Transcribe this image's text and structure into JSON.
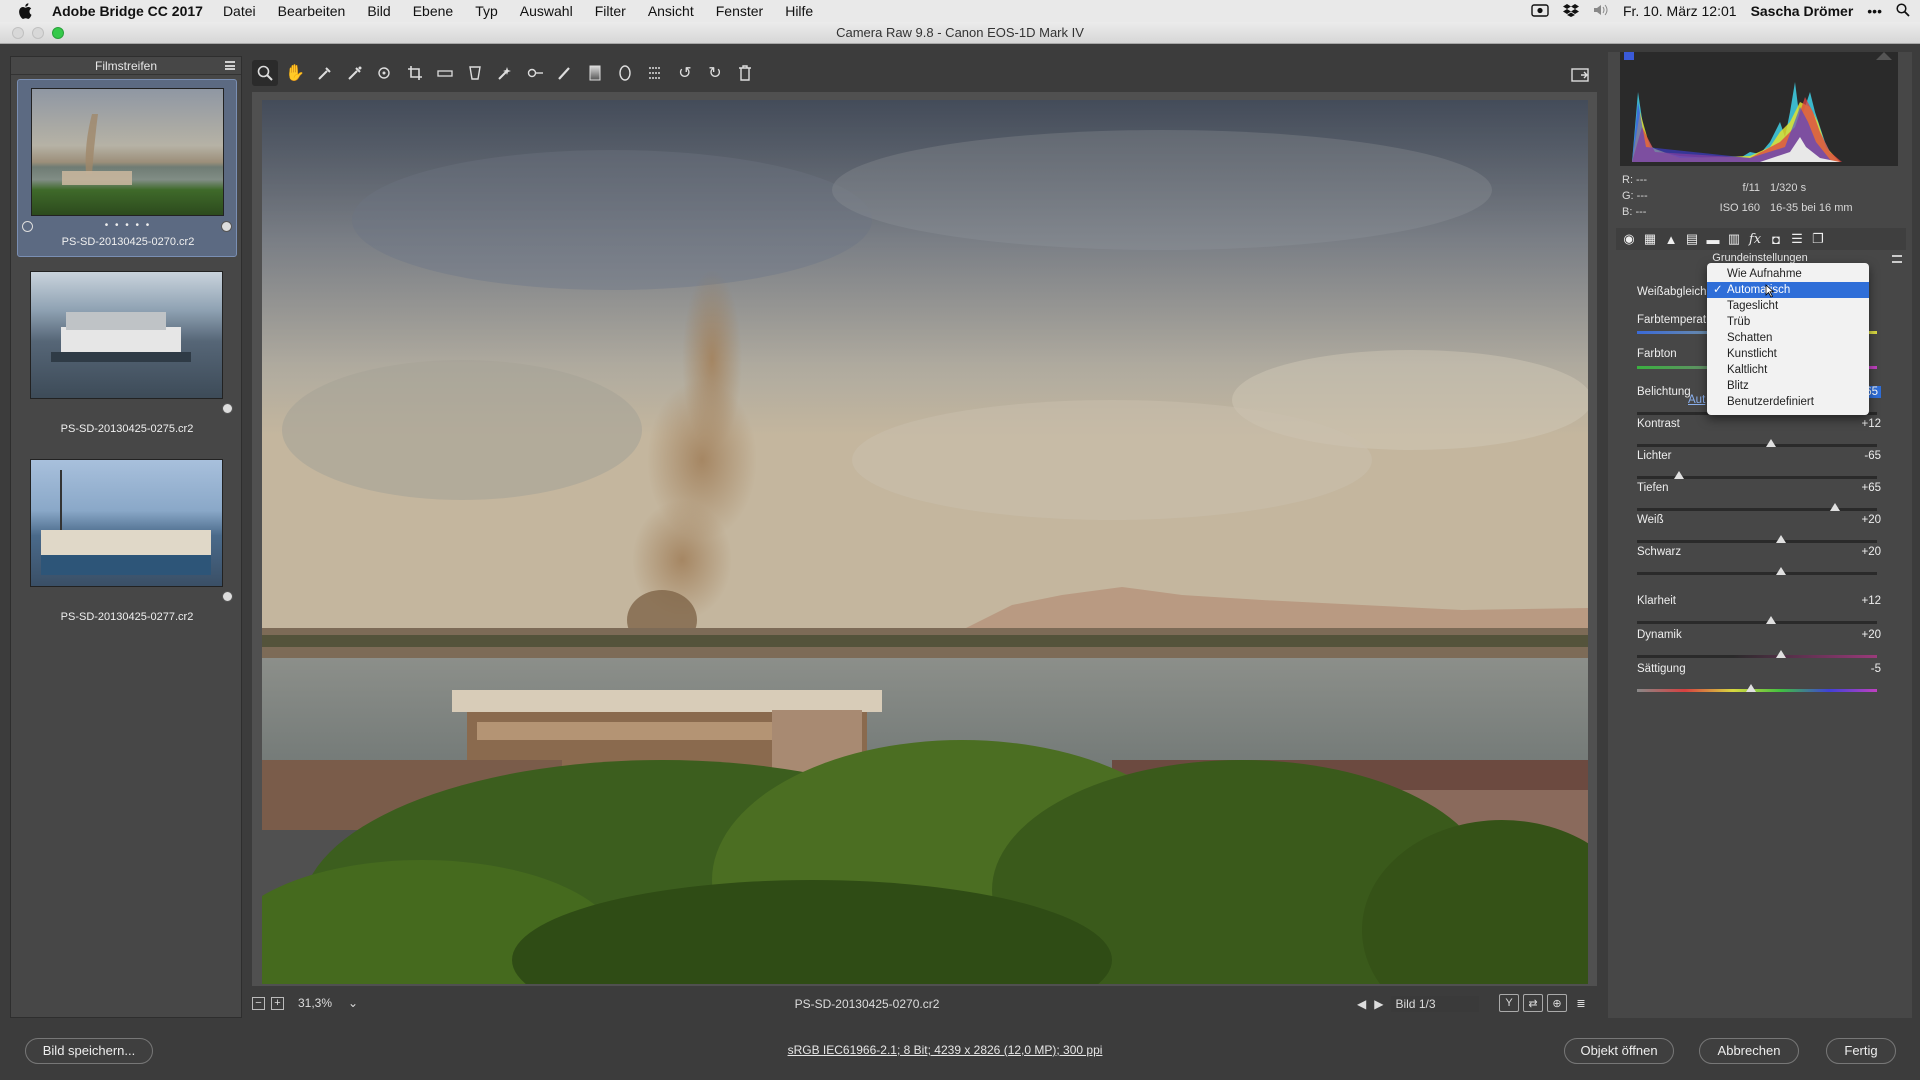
{
  "menubar": {
    "app": "Adobe Bridge CC 2017",
    "items": [
      "Datei",
      "Bearbeiten",
      "Bild",
      "Ebene",
      "Typ",
      "Auswahl",
      "Filter",
      "Ansicht",
      "Fenster",
      "Hilfe"
    ],
    "datetime": "Fr. 10. März  12:01",
    "user": "Sascha Drömer"
  },
  "window": {
    "title": "Camera Raw 9.8  -  Canon EOS-1D Mark IV"
  },
  "filmstrip": {
    "title": "Filmstreifen",
    "items": [
      {
        "name": "PS-SD-20130425-0270.cr2",
        "selected": true,
        "rating_dots": "• • • • •"
      },
      {
        "name": "PS-SD-20130425-0275.cr2",
        "selected": false
      },
      {
        "name": "PS-SD-20130425-0277.cr2",
        "selected": false
      }
    ]
  },
  "statusbar": {
    "zoom": "31,3%",
    "filename": "PS-SD-20130425-0270.cr2",
    "page": "Bild 1/3"
  },
  "histogram": {
    "rgb": {
      "r": "R:   ---",
      "g": "G:   ---",
      "b": "B:   ---"
    },
    "aperture": "f/11",
    "shutter": "1/320 s",
    "iso": "ISO 160",
    "lens": "16-35 bei 16 mm"
  },
  "panel": {
    "section_title": "Grundeinstellungen",
    "wb_label": "Weißabgleich",
    "temp_label": "Farbtemperat",
    "tint_label": "Farbton",
    "auto_link": "Aut",
    "sliders": [
      {
        "label": "Belichtung",
        "value": "-0,65",
        "level": 0.43,
        "highlight": true
      },
      {
        "label": "Kontrast",
        "value": "+12",
        "level": 0.56
      },
      {
        "label": "Lichter",
        "value": "-65",
        "level": 0.175
      },
      {
        "label": "Tiefen",
        "value": "+65",
        "level": 0.825
      },
      {
        "label": "Weiß",
        "value": "+20",
        "level": 0.6
      },
      {
        "label": "Schwarz",
        "value": "+20",
        "level": 0.6
      },
      {
        "label": "Klarheit",
        "value": "+12",
        "level": 0.56
      },
      {
        "label": "Dynamik",
        "value": "+20",
        "level": 0.6
      },
      {
        "label": "Sättigung",
        "value": "-5",
        "level": 0.475
      }
    ]
  },
  "wb_menu": {
    "options": [
      "Wie Aufnahme",
      "Automatisch",
      "Tageslicht",
      "Trüb",
      "Schatten",
      "Kunstlicht",
      "Kaltlicht",
      "Blitz",
      "Benutzerdefiniert"
    ],
    "selected": "Automatisch"
  },
  "bottom": {
    "save": "Bild speichern...",
    "file_info": "sRGB IEC61966-2.1; 8 Bit; 4239 x 2826 (12,0 MP); 300 ppi",
    "open": "Objekt öffnen",
    "cancel": "Abbrechen",
    "done": "Fertig"
  },
  "colors": {
    "accent": "#2f6ed8",
    "panel": "#474747",
    "background": "#3c3c3c"
  }
}
